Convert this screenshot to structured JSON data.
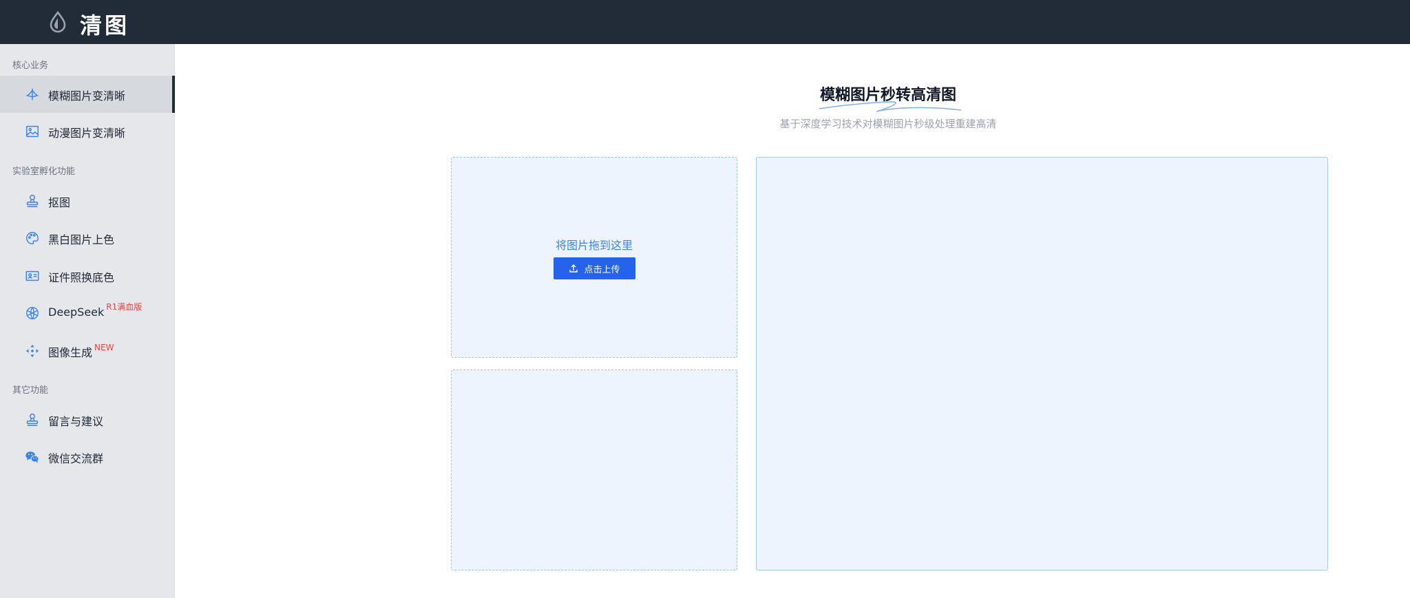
{
  "header": {
    "brand": "清图",
    "logo_icon": "droplet-icon",
    "background": "#222b38"
  },
  "sidebar": {
    "sections": [
      {
        "title": "核心业务"
      },
      {
        "title": "实验室孵化功能"
      },
      {
        "title": "其它功能"
      }
    ],
    "items": [
      {
        "label": "模糊图片变清晰",
        "icon": "enhance-icon",
        "active": true
      },
      {
        "label": "动漫图片变清晰",
        "icon": "image-icon"
      },
      {
        "label": "抠图",
        "icon": "stamp-icon"
      },
      {
        "label": "黑白图片上色",
        "icon": "palette-icon"
      },
      {
        "label": "证件照换底色",
        "icon": "id-card-icon"
      },
      {
        "label": "DeepSeek",
        "icon": "openai-icon",
        "badge": "R1满血版"
      },
      {
        "label": "图像生成",
        "icon": "move-icon",
        "badge": "NEW"
      },
      {
        "label": "留言与建议",
        "icon": "stamp-icon"
      },
      {
        "label": "微信交流群",
        "icon": "wechat-icon"
      }
    ]
  },
  "main": {
    "title": "模糊图片秒转高清图",
    "subtitle": "基于深度学习技术对模糊图片秒级处理重建高清",
    "upload": {
      "drop_text": "将图片拖到这里",
      "button_label": "点击上传",
      "button_icon": "upload-icon"
    }
  },
  "colors": {
    "accent": "#2563eb",
    "panel_bg": "#eef4fd",
    "badge": "#ef4444"
  }
}
